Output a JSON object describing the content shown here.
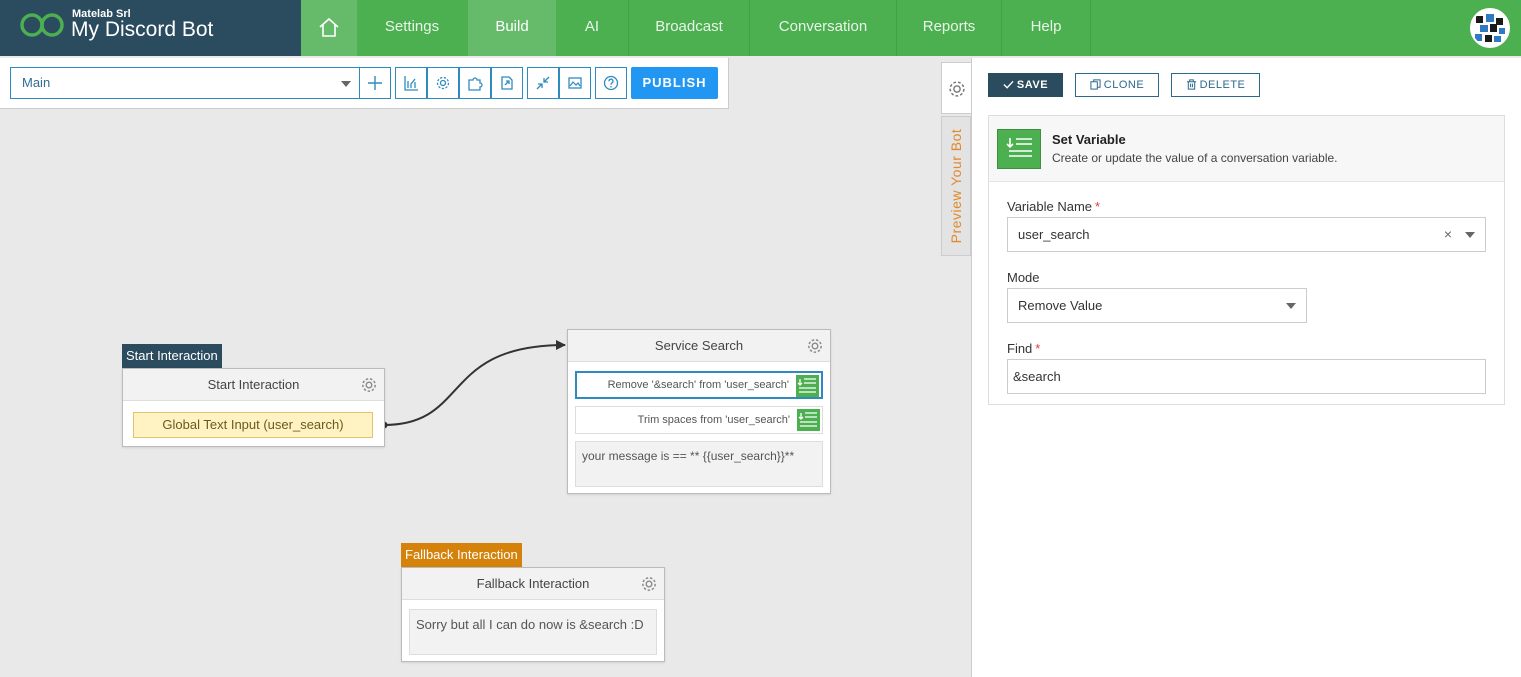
{
  "brand": {
    "company": "Matelab Srl",
    "app_name": "My Discord Bot"
  },
  "nav": {
    "items": [
      {
        "label": "Settings"
      },
      {
        "label": "Build",
        "active": true
      },
      {
        "label": "AI"
      },
      {
        "label": "Broadcast"
      },
      {
        "label": "Conversation"
      },
      {
        "label": "Reports"
      },
      {
        "label": "Help"
      }
    ]
  },
  "toolbar": {
    "flow_select": "Main",
    "publish_label": "PUBLISH",
    "icons": [
      "plus-icon",
      "chart-icon",
      "gear-icon",
      "puzzle-icon",
      "export-icon",
      "collapse-icon",
      "image-icon",
      "help-icon"
    ]
  },
  "canvas": {
    "start": {
      "tag": "Start Interaction",
      "title": "Start Interaction",
      "input": "Global Text Input (user_search)"
    },
    "service": {
      "title": "Service Search",
      "actions": [
        "Remove '&search' from 'user_search'",
        "Trim spaces from 'user_search'"
      ],
      "message": "your message is == ** {{user_search}}**"
    },
    "fallback": {
      "tag": "Fallback Interaction",
      "title": "Fallback Interaction",
      "message": "Sorry but all I can do now is &search :D"
    }
  },
  "sidetabs": {
    "preview_label": "Preview Your Bot"
  },
  "panel": {
    "save_label": "SAVE",
    "clone_label": "CLONE",
    "delete_label": "DELETE",
    "card_title": "Set Variable",
    "card_desc": "Create or update the value of a conversation variable.",
    "fields": {
      "variable_name_label": "Variable Name",
      "variable_name_value": "user_search",
      "mode_label": "Mode",
      "mode_value": "Remove Value",
      "find_label": "Find",
      "find_value": "&search"
    }
  },
  "colors": {
    "nav_green": "#4caf50",
    "brand_dark": "#2b4b5e",
    "accent_blue": "#2196f3",
    "start_tag": "#2b4b5e",
    "fallback_tag": "#d4820a"
  }
}
